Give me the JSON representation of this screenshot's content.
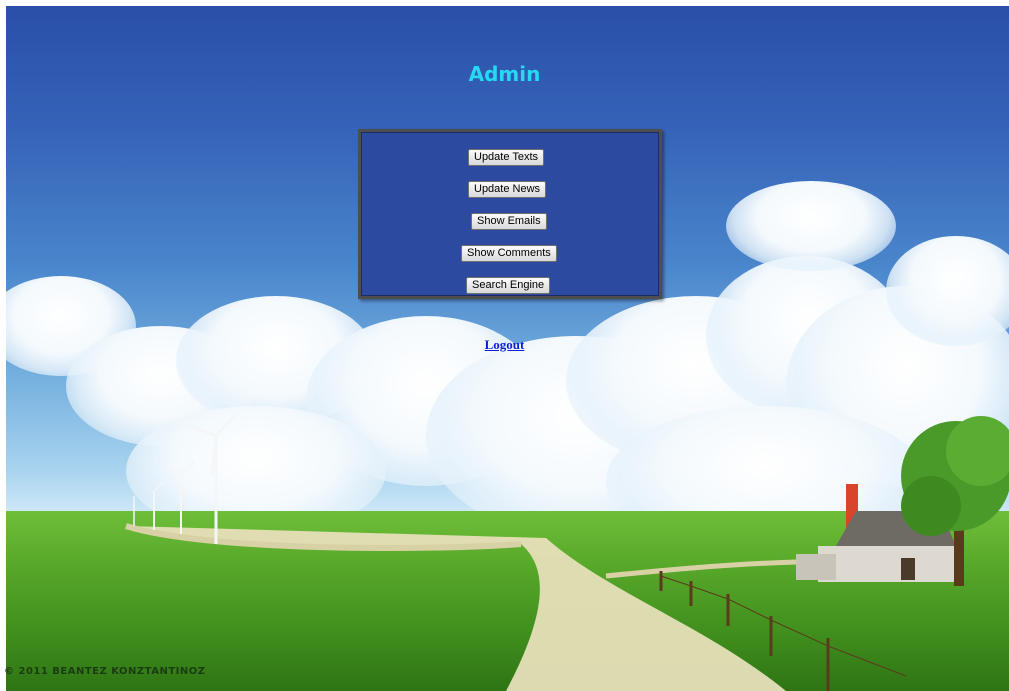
{
  "header": {
    "title": "Admin"
  },
  "menu": {
    "items": [
      {
        "label": "Update Texts"
      },
      {
        "label": "Update News"
      },
      {
        "label": "Show Emails"
      },
      {
        "label": "Show Comments"
      },
      {
        "label": "Search Engine"
      }
    ]
  },
  "logout": {
    "label": "Logout"
  },
  "footer": {
    "copyright": "© 2011 BEANTEZ KONZTANTINOZ"
  },
  "colors": {
    "title": "#27d8f2",
    "panel_bg": "#2c4aa0",
    "panel_border": "#4e4e4e",
    "link": "#0a1fd6"
  }
}
